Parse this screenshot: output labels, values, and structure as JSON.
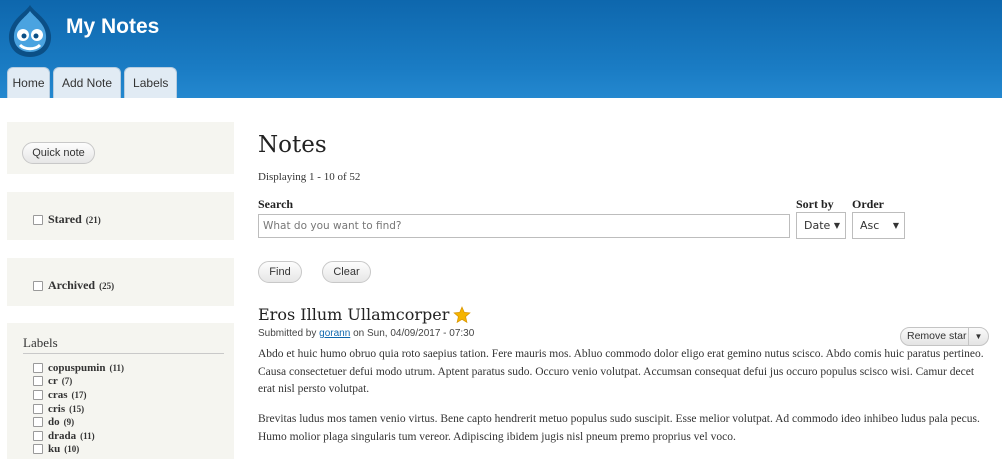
{
  "header": {
    "site_name": "My Notes",
    "tabs": [
      "Home",
      "Add Note",
      "Labels"
    ]
  },
  "sidebar": {
    "quick_note": "Quick note",
    "stared": {
      "label": "Stared",
      "count": "(21)"
    },
    "archived": {
      "label": "Archived",
      "count": "(25)"
    },
    "labels_title": "Labels",
    "labels": [
      {
        "name": "copuspumin",
        "count": "(11)"
      },
      {
        "name": "cr",
        "count": "(7)"
      },
      {
        "name": "cras",
        "count": "(17)"
      },
      {
        "name": "cris",
        "count": "(15)"
      },
      {
        "name": "do",
        "count": "(9)"
      },
      {
        "name": "drada",
        "count": "(11)"
      },
      {
        "name": "ku",
        "count": "(10)"
      }
    ]
  },
  "main": {
    "title": "Notes",
    "displaying": "Displaying 1 - 10 of 52",
    "search_label": "Search",
    "search_placeholder": "What do you want to find?",
    "sort_label": "Sort by",
    "sort_value": "Date",
    "order_label": "Order",
    "order_value": "Asc",
    "find": "Find",
    "clear": "Clear"
  },
  "note": {
    "title": "Eros Illum Ullamcorper",
    "submitted_prefix": "Submitted by",
    "author": "gorann",
    "submitted_suffix": "on Sun, 04/09/2017 - 07:30",
    "remove_star": "Remove star",
    "body_1": "Abdo et huic humo obruo quia roto saepius tation. Fere mauris mos. Abluo commodo dolor eligo erat gemino nutus scisco. Abdo comis huic paratus pertineo. Causa consectetuer defui modo utrum. Aptent paratus sudo. Occuro venio volutpat. Accumsan consequat defui jus occuro populus scisco wisi. Camur decet erat nisl persto volutpat.",
    "body_2": "Brevitas ludus mos tamen venio virtus. Bene capto hendrerit metuo populus sudo suscipit. Esse melior volutpat. Ad commodo ideo inhibeo ludus pala pecus. Humo molior plaga singularis tum vereor. Adipiscing ibidem jugis nisl pneum premo proprius vel voco."
  },
  "colors": {
    "header_blue": "#1a7cc4",
    "tab_bg": "#e1ebf4",
    "sidebar_bg": "#f5f5f0",
    "link": "#0e67ad",
    "star": "#f5b400"
  }
}
